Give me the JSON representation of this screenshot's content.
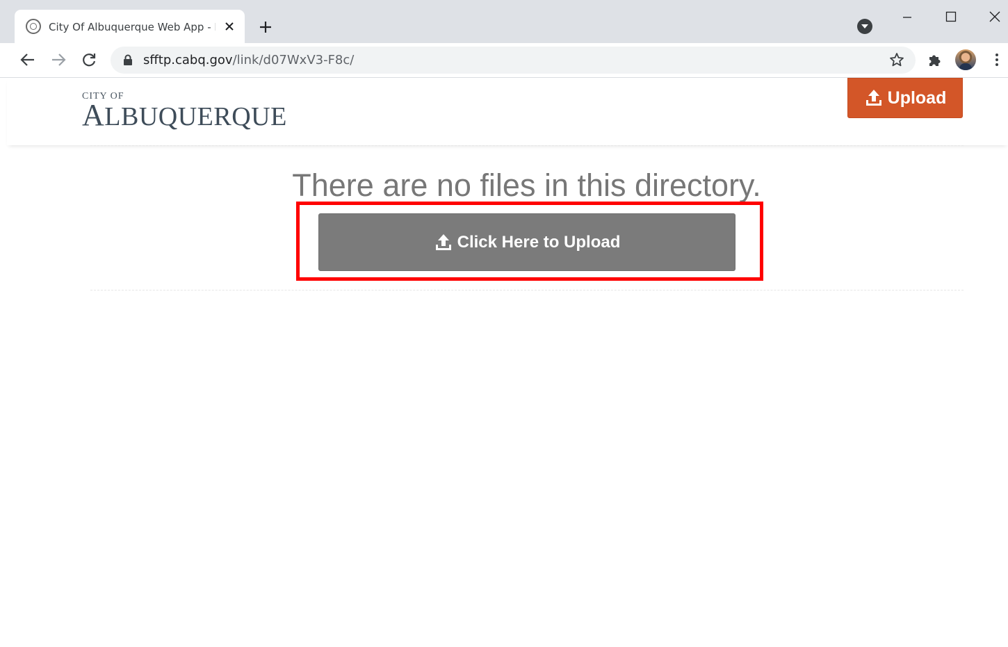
{
  "browser": {
    "tab_title": "City Of Albuquerque Web App - Fi",
    "url_host": "sfftp.cabq.gov",
    "url_path": "/link/d07WxV3-F8c/"
  },
  "header": {
    "logo_small": "CITY OF",
    "logo_big_cap": "A",
    "logo_big_rest": "LBUQUERQUE",
    "upload_label": "Upload"
  },
  "main": {
    "empty_message": "There are no files in this directory.",
    "upload_button_label": "Click Here to Upload"
  },
  "colors": {
    "accent_orange": "#d35628",
    "button_gray": "#7b7b7b",
    "highlight_red": "#ff0000"
  },
  "icons": {
    "tab_favicon": "city-seal-icon",
    "upload": "upload-icon",
    "extensions": "puzzle-icon"
  }
}
